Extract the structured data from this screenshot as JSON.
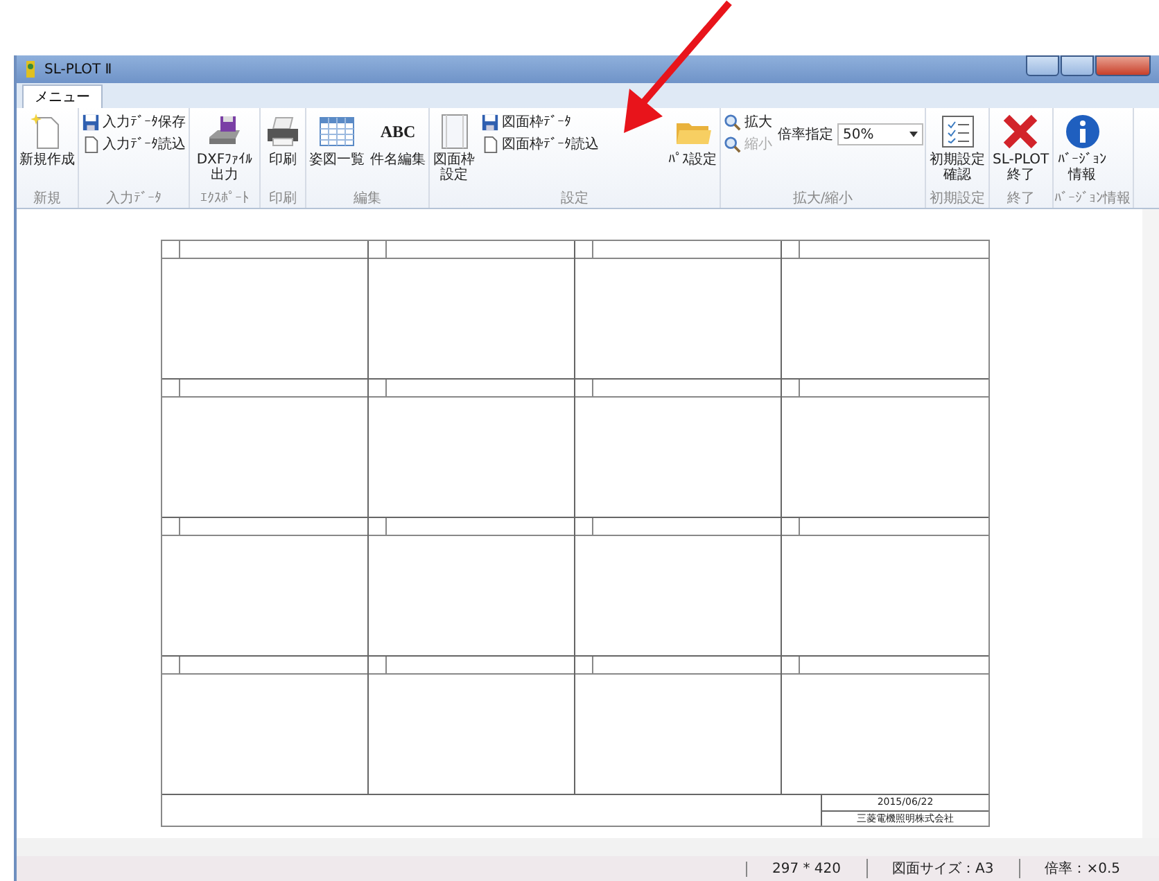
{
  "window": {
    "title": "SL-PLOT Ⅱ"
  },
  "tabs": [
    {
      "label": "メニュー",
      "selected": true
    }
  ],
  "ribbon": [
    {
      "label": "新規",
      "columns": [
        [
          {
            "kind": "large",
            "label": "新規作成",
            "disabled": false
          }
        ]
      ]
    },
    {
      "label": "入力ﾃﾞｰﾀ",
      "columns": [
        [
          {
            "kind": "small",
            "label": "入力ﾃﾞｰﾀ保存",
            "disabled": false
          },
          {
            "kind": "small",
            "label": "入力ﾃﾞｰﾀ読込",
            "disabled": false
          }
        ]
      ]
    },
    {
      "label": "ｴｸｽﾎﾟｰﾄ",
      "columns": [
        [
          {
            "kind": "large",
            "label": "DXFﾌｧｲﾙ出力",
            "disabled": false
          }
        ]
      ]
    },
    {
      "label": "印刷",
      "columns": [
        [
          {
            "kind": "large",
            "label": "印刷",
            "disabled": false
          }
        ]
      ]
    },
    {
      "label": "編集",
      "columns": [
        [
          {
            "kind": "large",
            "label": "姿図一覧",
            "disabled": false
          }
        ],
        [
          {
            "kind": "large",
            "label": "件名編集",
            "icon_text": "ABC",
            "disabled": false
          }
        ]
      ]
    },
    {
      "label": "設定",
      "columns": [
        [
          {
            "kind": "large",
            "label": "図面枠設定",
            "disabled": false
          }
        ],
        [
          {
            "kind": "small",
            "label": "図面枠ﾃﾞｰﾀ",
            "disabled": false
          },
          {
            "kind": "small",
            "label": "図面枠ﾃﾞｰﾀ読込",
            "disabled": false
          }
        ],
        [
          {
            "kind": "large",
            "label": "ﾊﾟｽ設定",
            "disabled": false
          }
        ]
      ]
    },
    {
      "label": "拡大/縮小",
      "columns": [
        [
          {
            "kind": "small",
            "label": "拡大",
            "disabled": false
          },
          {
            "kind": "small",
            "label": "縮小",
            "disabled": true
          }
        ],
        [
          {
            "kind": "dropdown",
            "label": "倍率指定",
            "value": "50%",
            "disabled": false
          }
        ]
      ]
    },
    {
      "label": "初期設定",
      "columns": [
        [
          {
            "kind": "large",
            "label": "初期設定確認",
            "disabled": false
          }
        ]
      ]
    },
    {
      "label": "終了",
      "columns": [
        [
          {
            "kind": "large",
            "label": "SL-PLOT\n終了",
            "disabled": false
          }
        ]
      ]
    },
    {
      "label": "ﾊﾞｰｼﾞｮﾝ情報",
      "columns": [
        [
          {
            "kind": "large",
            "label": "ﾊﾞｰｼﾞｮﾝ情報",
            "disabled": false
          }
        ]
      ]
    }
  ],
  "drawing": {
    "date": "2015/06/22",
    "company": "三菱電機照明株式会社"
  },
  "status_bar": [
    "297 * 420",
    "図面サイズ：A3",
    "倍率：×0.5"
  ]
}
